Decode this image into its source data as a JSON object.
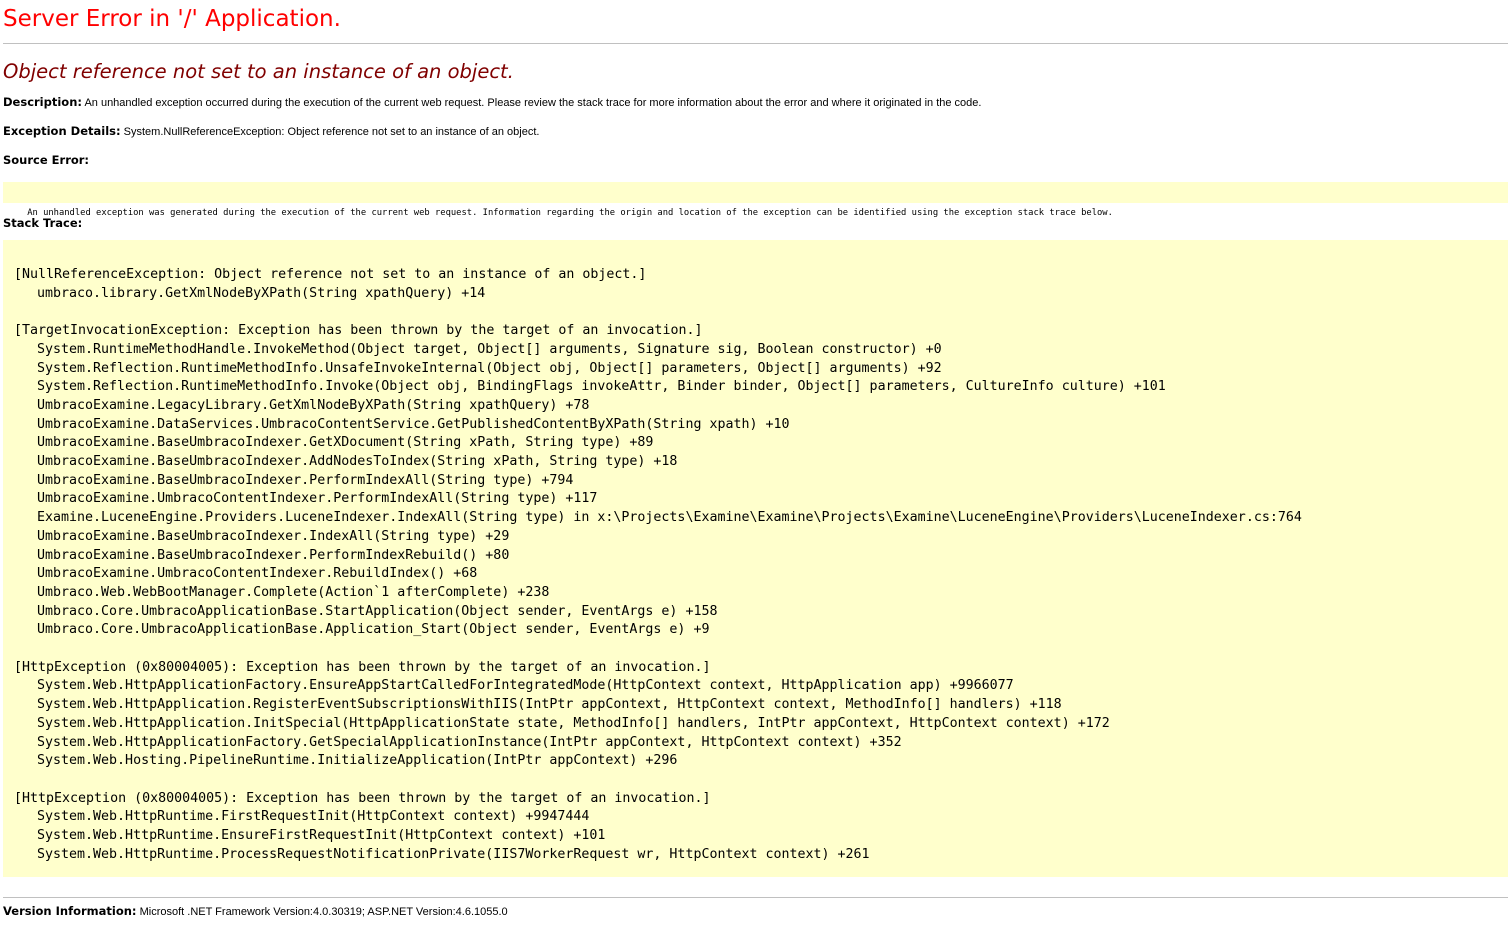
{
  "page": {
    "title": "Server Error in '/' Application.",
    "message": "Object reference not set to an instance of an object."
  },
  "description": {
    "label": "Description:",
    "text": "An unhandled exception occurred during the execution of the current web request. Please review the stack trace for more information about the error and where it originated in the code."
  },
  "exception_details": {
    "label": "Exception Details:",
    "text": "System.NullReferenceException: Object reference not set to an instance of an object."
  },
  "source_error": {
    "label": "Source Error:",
    "text": "An unhandled exception was generated during the execution of the current web request. Information regarding the origin and location of the exception can be identified using the exception stack trace below."
  },
  "stack_trace": {
    "label": "Stack Trace:",
    "blocks": [
      {
        "header": "[NullReferenceException: Object reference not set to an instance of an object.]",
        "frames": [
          "umbraco.library.GetXmlNodeByXPath(String xpathQuery) +14"
        ]
      },
      {
        "header": "[TargetInvocationException: Exception has been thrown by the target of an invocation.]",
        "frames": [
          "System.RuntimeMethodHandle.InvokeMethod(Object target, Object[] arguments, Signature sig, Boolean constructor) +0",
          "System.Reflection.RuntimeMethodInfo.UnsafeInvokeInternal(Object obj, Object[] parameters, Object[] arguments) +92",
          "System.Reflection.RuntimeMethodInfo.Invoke(Object obj, BindingFlags invokeAttr, Binder binder, Object[] parameters, CultureInfo culture) +101",
          "UmbracoExamine.LegacyLibrary.GetXmlNodeByXPath(String xpathQuery) +78",
          "UmbracoExamine.DataServices.UmbracoContentService.GetPublishedContentByXPath(String xpath) +10",
          "UmbracoExamine.BaseUmbracoIndexer.GetXDocument(String xPath, String type) +89",
          "UmbracoExamine.BaseUmbracoIndexer.AddNodesToIndex(String xPath, String type) +18",
          "UmbracoExamine.BaseUmbracoIndexer.PerformIndexAll(String type) +794",
          "UmbracoExamine.UmbracoContentIndexer.PerformIndexAll(String type) +117",
          "Examine.LuceneEngine.Providers.LuceneIndexer.IndexAll(String type) in x:\\Projects\\Examine\\Examine\\Projects\\Examine\\LuceneEngine\\Providers\\LuceneIndexer.cs:764",
          "UmbracoExamine.BaseUmbracoIndexer.IndexAll(String type) +29",
          "UmbracoExamine.BaseUmbracoIndexer.PerformIndexRebuild() +80",
          "UmbracoExamine.UmbracoContentIndexer.RebuildIndex() +68",
          "Umbraco.Web.WebBootManager.Complete(Action`1 afterComplete) +238",
          "Umbraco.Core.UmbracoApplicationBase.StartApplication(Object sender, EventArgs e) +158",
          "Umbraco.Core.UmbracoApplicationBase.Application_Start(Object sender, EventArgs e) +9"
        ]
      },
      {
        "header": "[HttpException (0x80004005): Exception has been thrown by the target of an invocation.]",
        "frames": [
          "System.Web.HttpApplicationFactory.EnsureAppStartCalledForIntegratedMode(HttpContext context, HttpApplication app) +9966077",
          "System.Web.HttpApplication.RegisterEventSubscriptionsWithIIS(IntPtr appContext, HttpContext context, MethodInfo[] handlers) +118",
          "System.Web.HttpApplication.InitSpecial(HttpApplicationState state, MethodInfo[] handlers, IntPtr appContext, HttpContext context) +172",
          "System.Web.HttpApplicationFactory.GetSpecialApplicationInstance(IntPtr appContext, HttpContext context) +352",
          "System.Web.Hosting.PipelineRuntime.InitializeApplication(IntPtr appContext) +296"
        ]
      },
      {
        "header": "[HttpException (0x80004005): Exception has been thrown by the target of an invocation.]",
        "frames": [
          "System.Web.HttpRuntime.FirstRequestInit(HttpContext context) +9947444",
          "System.Web.HttpRuntime.EnsureFirstRequestInit(HttpContext context) +101",
          "System.Web.HttpRuntime.ProcessRequestNotificationPrivate(IIS7WorkerRequest wr, HttpContext context) +261"
        ]
      }
    ]
  },
  "version_info": {
    "label": "Version Information:",
    "text": "Microsoft .NET Framework Version:4.0.30319; ASP.NET Version:4.6.1055.0"
  },
  "colors": {
    "title": "#ff0000",
    "message": "#800000",
    "code_background": "#ffffcc",
    "rule": "#c0c0c0"
  }
}
